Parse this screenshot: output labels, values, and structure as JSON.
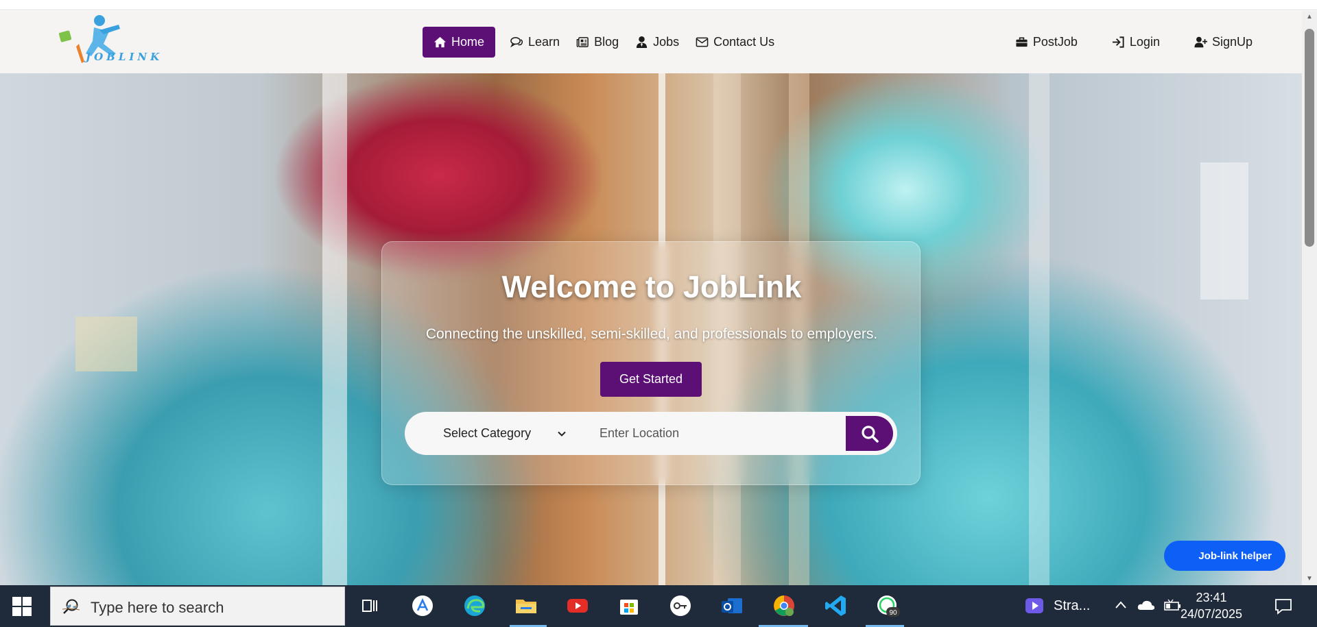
{
  "navbar": {
    "logo_text": "JOBLINK",
    "items": [
      {
        "label": "Home",
        "icon": "home-icon",
        "active": true
      },
      {
        "label": "Learn",
        "icon": "comments-icon"
      },
      {
        "label": "Blog",
        "icon": "newspaper-icon"
      },
      {
        "label": "Jobs",
        "icon": "user-tie-icon"
      },
      {
        "label": "Contact Us",
        "icon": "envelope-icon"
      }
    ],
    "right_items": [
      {
        "label": "PostJob",
        "icon": "briefcase-icon"
      },
      {
        "label": "Login",
        "icon": "sign-in-icon"
      },
      {
        "label": "SignUp",
        "icon": "user-plus-icon"
      }
    ]
  },
  "hero": {
    "title": "Welcome to JobLink",
    "subtitle": "Connecting the unskilled, semi-skilled, and professionals to employers.",
    "cta_label": "Get Started",
    "search": {
      "category_label": "Select Category",
      "location_placeholder": "Enter Location"
    }
  },
  "helper": {
    "label": "Job-link helper"
  },
  "taskbar": {
    "search_placeholder": "Type here to search",
    "pinned_app_label": "Stra...",
    "time": "23:41",
    "date": "24/07/2025",
    "badge": "90"
  },
  "colors": {
    "accent": "#5c0f74",
    "helper": "#0d5ff5",
    "taskbar": "#1f2a3a"
  }
}
